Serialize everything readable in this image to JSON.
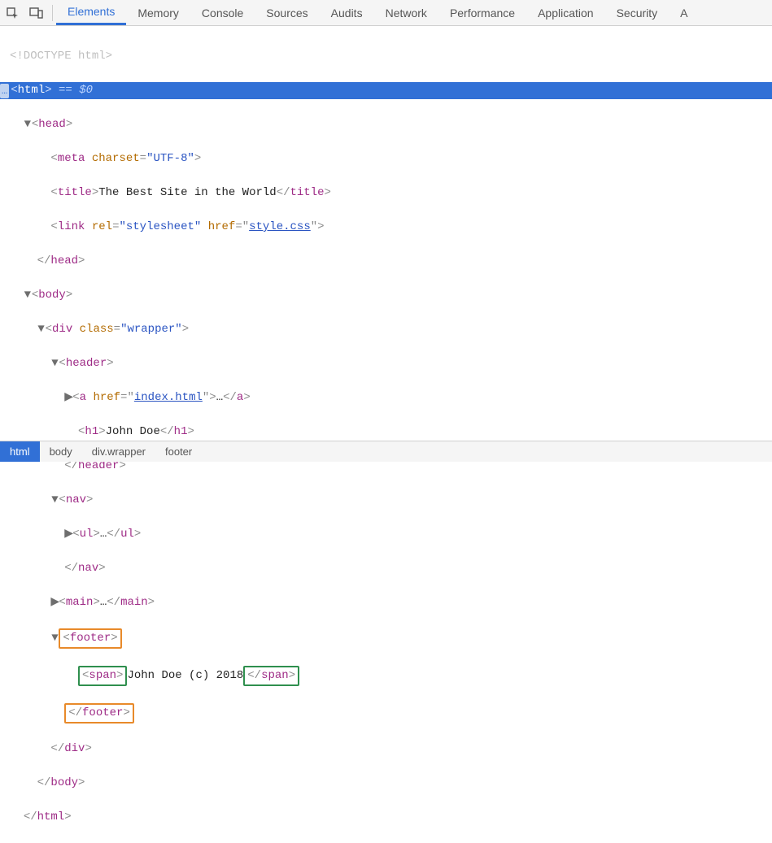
{
  "tabs": {
    "elements": "Elements",
    "memory": "Memory",
    "console": "Console",
    "sources": "Sources",
    "audits": "Audits",
    "network": "Network",
    "performance": "Performance",
    "application": "Application",
    "security": "Security",
    "last": "A"
  },
  "tree": {
    "doctype": "<!DOCTYPE html>",
    "html_open": "html",
    "eq0": " == $0",
    "head_open": "head",
    "meta_charset_attr": "charset",
    "meta_charset_val": "\"UTF-8\"",
    "title_txt": "The Best Site in the World",
    "link_rel_attr": "rel",
    "link_rel_val": "\"stylesheet\"",
    "link_href_attr": "href",
    "link_href_val": "style.css",
    "head_close": "head",
    "body_open": "body",
    "div_class_attr": "class",
    "div_class_val": "\"wrapper\"",
    "header_open": "header",
    "a_href_attr": "href",
    "a_href_val": "index.html",
    "h1_txt": "John Doe",
    "header_close": "header",
    "nav_open": "nav",
    "ul_open": "ul",
    "ul_close": "ul",
    "nav_close": "nav",
    "main_open": "main",
    "main_close": "main",
    "footer_open": "footer",
    "span_open": "span",
    "footer_txt": "John Doe (c) 2018",
    "span_close": "span",
    "footer_close": "footer",
    "div_close": "div",
    "body_close": "body",
    "html_close": "html",
    "ellipsis": "…"
  },
  "breadcrumb": {
    "b1": "html",
    "b2": "body",
    "b3": "div.wrapper",
    "b4": "footer"
  }
}
